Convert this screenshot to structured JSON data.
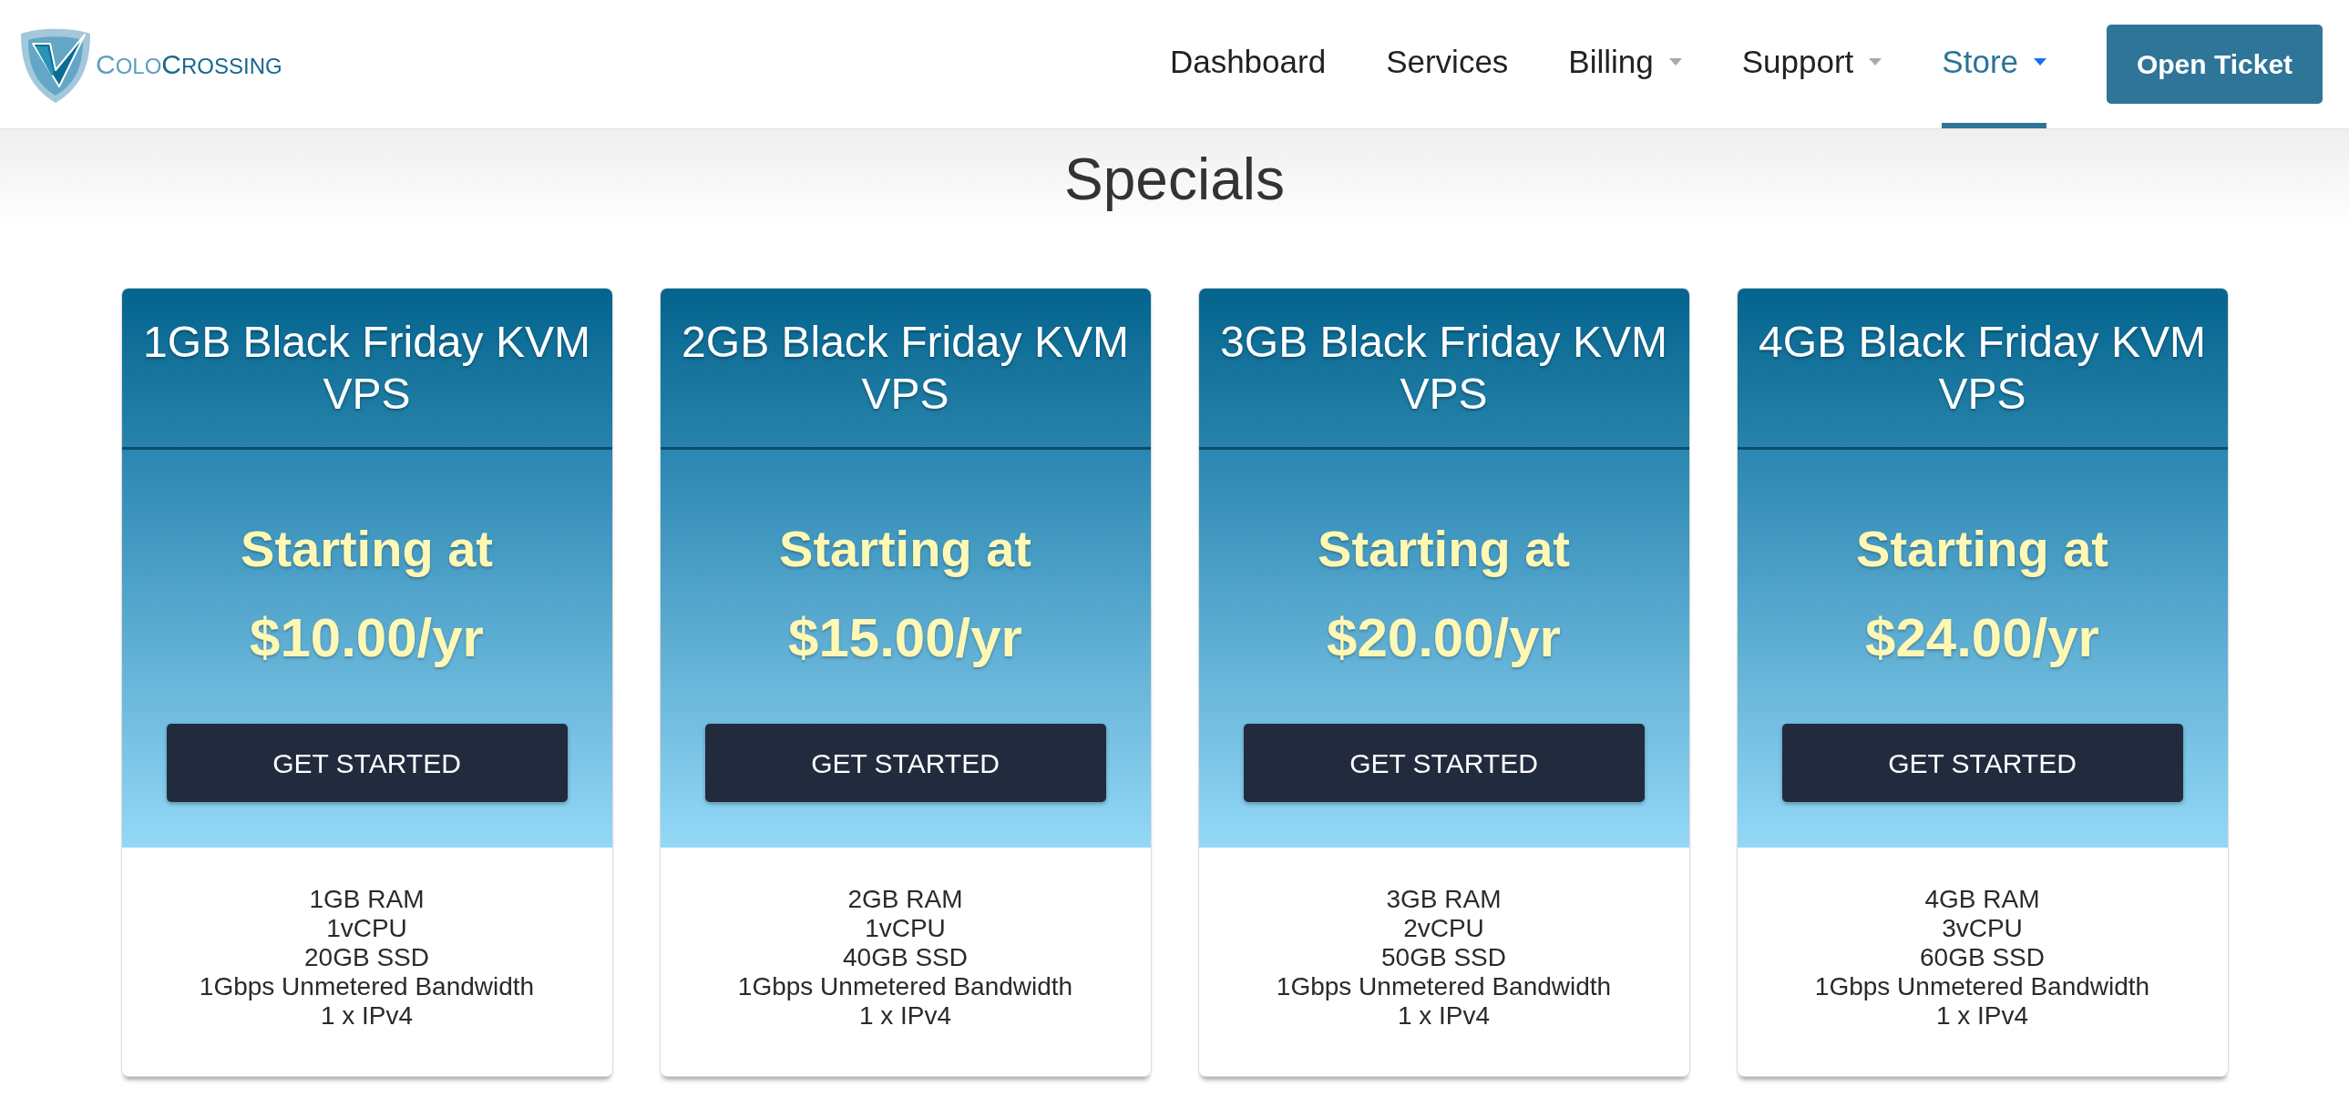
{
  "header": {
    "logo": {
      "name_parts": [
        "COLO",
        "CROSSING"
      ]
    },
    "nav": [
      {
        "label": "Dashboard",
        "dropdown": false,
        "selected": false
      },
      {
        "label": "Services",
        "dropdown": false,
        "selected": false
      },
      {
        "label": "Billing",
        "dropdown": true,
        "selected": false
      },
      {
        "label": "Support",
        "dropdown": true,
        "selected": false
      },
      {
        "label": "Store",
        "dropdown": true,
        "selected": true
      }
    ],
    "action_button": "Open Ticket"
  },
  "section": {
    "title": "Specials"
  },
  "products": [
    {
      "title": "1GB Black Friday KVM VPS",
      "tagline": "Starting at",
      "price": "$10.00/yr",
      "button": "GET STARTED",
      "features": [
        "1GB RAM",
        "1vCPU",
        "20GB SSD",
        "1Gbps Unmetered Bandwidth",
        "1 x IPv4"
      ]
    },
    {
      "title": "2GB Black Friday KVM VPS",
      "tagline": "Starting at",
      "price": "$15.00/yr",
      "button": "GET STARTED",
      "features": [
        "2GB RAM",
        "1vCPU",
        "40GB SSD",
        "1Gbps Unmetered Bandwidth",
        "1 x IPv4"
      ]
    },
    {
      "title": "3GB Black Friday KVM VPS",
      "tagline": "Starting at",
      "price": "$20.00/yr",
      "button": "GET STARTED",
      "features": [
        "3GB RAM",
        "2vCPU",
        "50GB SSD",
        "1Gbps Unmetered Bandwidth",
        "1 x IPv4"
      ]
    },
    {
      "title": "4GB Black Friday KVM VPS",
      "tagline": "Starting at",
      "price": "$24.00/yr",
      "button": "GET STARTED",
      "features": [
        "4GB RAM",
        "3vCPU",
        "60GB SSD",
        "1Gbps Unmetered Bandwidth",
        "1 x IPv4"
      ]
    }
  ]
}
